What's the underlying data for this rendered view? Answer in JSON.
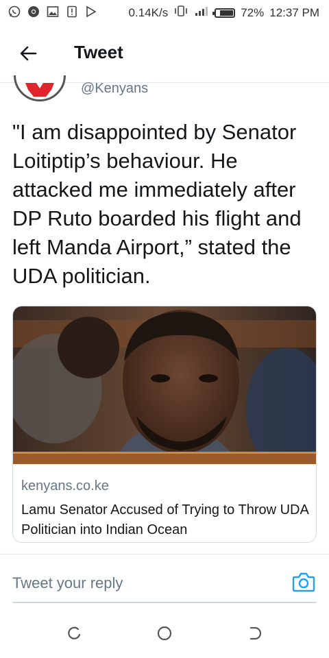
{
  "status_bar": {
    "network_speed": "0.14K/s",
    "battery_percent": "72%",
    "battery_level": 0.72,
    "time": "12:37 PM",
    "icons": [
      "whatsapp-icon",
      "chrome-icon",
      "image-icon",
      "alert-icon",
      "play-store-icon",
      "vibrate-icon",
      "signal-icon",
      "battery-icon"
    ]
  },
  "header": {
    "back_icon": "arrow-left-icon",
    "title": "Tweet"
  },
  "tweet": {
    "handle": "@Kenyans",
    "text": "\"I am disappointed by Senator Loitiptip’s behaviour. He attacked me immediately after DP Ruto boarded his flight and left Manda Airport,” stated the UDA politician."
  },
  "card": {
    "domain": "kenyans.co.ke",
    "title": "Lamu Senator Accused of Trying to Throw UDA Politician into Indian Ocean"
  },
  "reply": {
    "placeholder": "Tweet your reply",
    "camera_icon": "camera-icon",
    "accent_color": "#1da1f2"
  },
  "nav": {
    "icons": [
      "recent-apps-icon",
      "home-icon",
      "back-icon"
    ]
  }
}
